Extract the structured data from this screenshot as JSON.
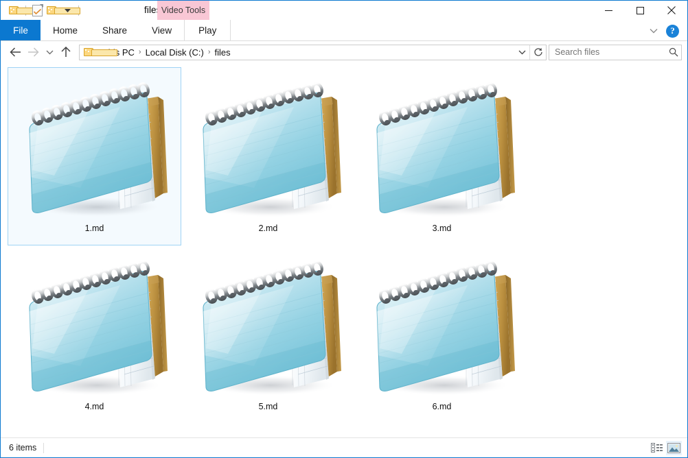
{
  "window": {
    "title": "files",
    "accent_blue": "#0b78d0",
    "border_color": "#0b78d0"
  },
  "quick_access": {
    "items": [
      {
        "name": "folder-icon",
        "label": "Customize Quick Access Toolbar"
      },
      {
        "name": "properties-icon",
        "label": "Properties"
      },
      {
        "name": "new-folder-icon",
        "label": "New folder"
      },
      {
        "name": "chevron-down-icon",
        "label": "Customize"
      }
    ]
  },
  "window_controls": {
    "minimize": "Minimize",
    "maximize": "Maximize",
    "close": "Close"
  },
  "ribbon": {
    "file_tab": "File",
    "tabs": [
      {
        "label": "Home"
      },
      {
        "label": "Share"
      },
      {
        "label": "View"
      }
    ],
    "contextual": {
      "label": "Video Tools",
      "color": "#f9c7d5",
      "tab": "Play"
    },
    "collapse_label": "Minimize the Ribbon",
    "help_label": "?"
  },
  "navigation": {
    "back": "Back",
    "forward": "Forward",
    "recent": "Recent locations",
    "up": "Up",
    "breadcrumbs": [
      {
        "label": "This PC"
      },
      {
        "label": "Local Disk (C:)"
      },
      {
        "label": "files"
      }
    ],
    "separator": "›",
    "dropdown": "Previous locations",
    "refresh": "Refresh"
  },
  "search": {
    "placeholder": "Search files",
    "value": "",
    "icon": "search-icon"
  },
  "files": [
    {
      "name": "1.md",
      "icon": "notepad-icon",
      "selected": true
    },
    {
      "name": "2.md",
      "icon": "notepad-icon",
      "selected": false
    },
    {
      "name": "3.md",
      "icon": "notepad-icon",
      "selected": false
    },
    {
      "name": "4.md",
      "icon": "notepad-icon",
      "selected": false
    },
    {
      "name": "5.md",
      "icon": "notepad-icon",
      "selected": false
    },
    {
      "name": "6.md",
      "icon": "notepad-icon",
      "selected": false
    }
  ],
  "status": {
    "item_count": "6 items",
    "details_view": "Details view",
    "large_icons_view": "Large icons view"
  }
}
